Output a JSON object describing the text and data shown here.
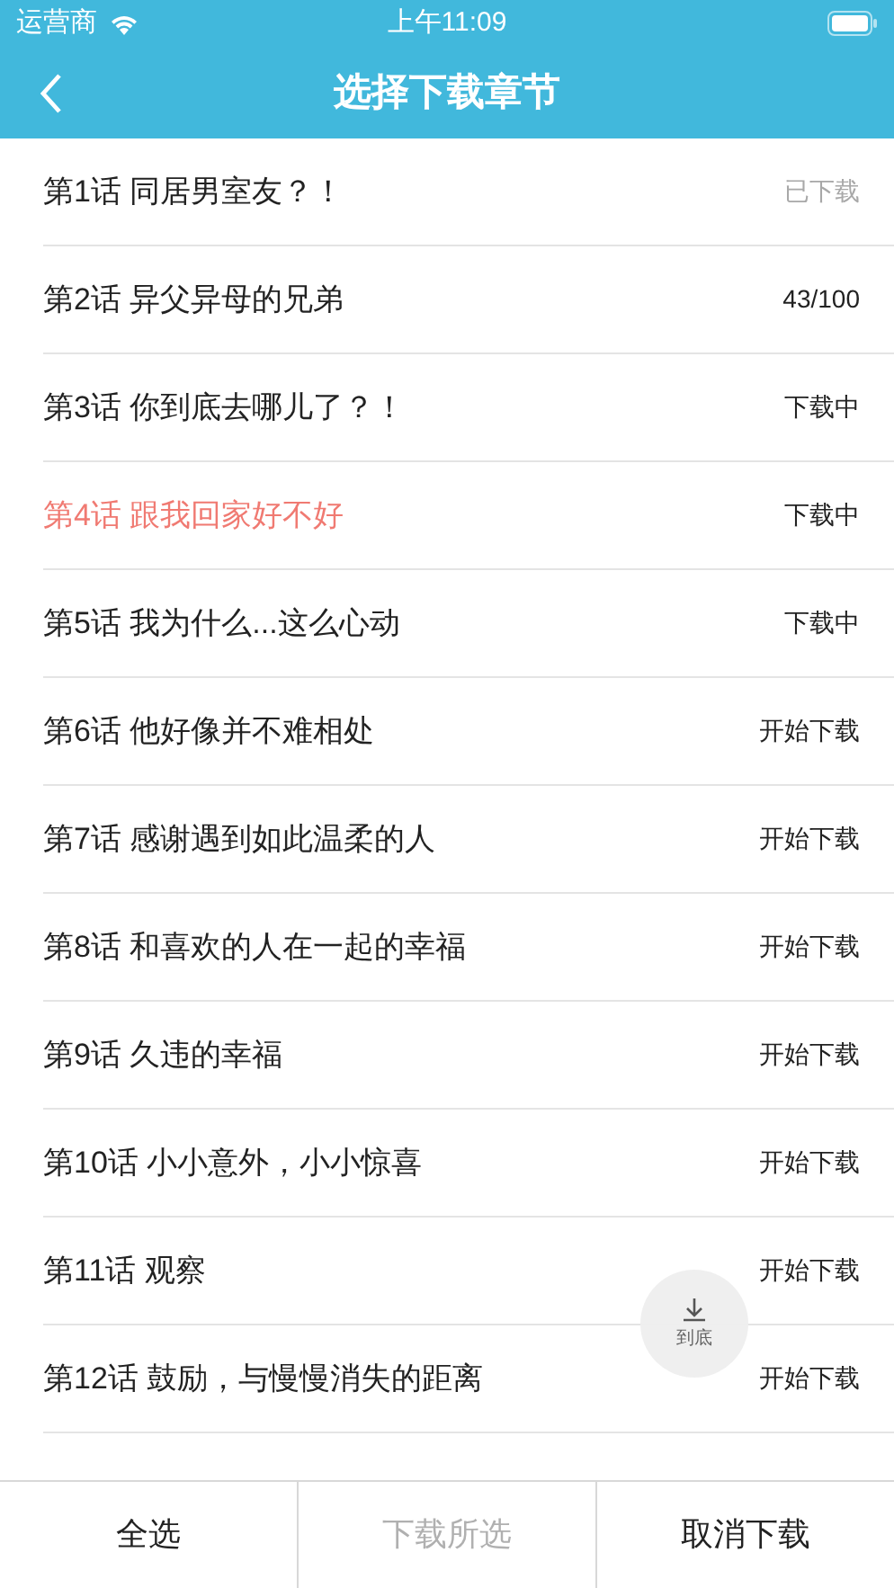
{
  "status_bar": {
    "carrier": "运营商",
    "time": "上午11:09"
  },
  "nav": {
    "title": "选择下载章节"
  },
  "chapters": [
    {
      "title": "第1话 同居男室友？！",
      "status": "已下载",
      "kind": "done",
      "selected": false
    },
    {
      "title": "第2话 异父异母的兄弟",
      "status": "43/100",
      "kind": "progress",
      "selected": false
    },
    {
      "title": "第3话 你到底去哪儿了？！",
      "status": "下载中",
      "kind": "downloading",
      "selected": false
    },
    {
      "title": "第4话 跟我回家好不好",
      "status": "下载中",
      "kind": "downloading",
      "selected": true
    },
    {
      "title": "第5话 我为什么...这么心动",
      "status": "下载中",
      "kind": "downloading",
      "selected": false
    },
    {
      "title": "第6话 他好像并不难相处",
      "status": "开始下载",
      "kind": "start",
      "selected": false
    },
    {
      "title": "第7话 感谢遇到如此温柔的人",
      "status": "开始下载",
      "kind": "start",
      "selected": false
    },
    {
      "title": "第8话 和喜欢的人在一起的幸福",
      "status": "开始下载",
      "kind": "start",
      "selected": false
    },
    {
      "title": "第9话 久违的幸福",
      "status": "开始下载",
      "kind": "start",
      "selected": false
    },
    {
      "title": "第10话 小小意外，小小惊喜",
      "status": "开始下载",
      "kind": "start",
      "selected": false
    },
    {
      "title": "第11话 观察",
      "status": "开始下载",
      "kind": "start",
      "selected": false
    },
    {
      "title": "第12话 鼓励，与慢慢消失的距离",
      "status": "开始下载",
      "kind": "start",
      "selected": false
    }
  ],
  "scroll_bottom_button": {
    "label": "到底"
  },
  "bottom_bar": [
    {
      "label": "全选",
      "disabled": false
    },
    {
      "label": "下载所选",
      "disabled": true
    },
    {
      "label": "取消下载",
      "disabled": false
    }
  ]
}
